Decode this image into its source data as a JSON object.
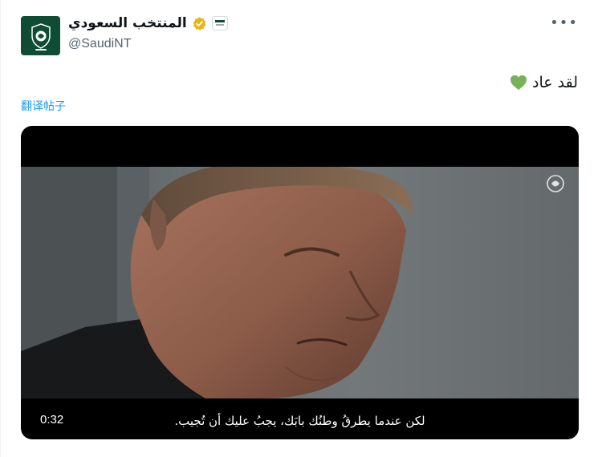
{
  "post": {
    "author": {
      "display_name": "المنتخب السعودي",
      "handle": "@SaudiNT",
      "verified_badge_color": "#e2b719",
      "avatar_icon": "saudi-team-crest-icon"
    },
    "more_icon": "more-dots-icon",
    "text": "لقد عاد",
    "text_emoji": "green-heart-icon",
    "translate_label": "翻译帖子",
    "video": {
      "duration": "0:32",
      "subtitle": "لكن عندما يطرقُ وطنُك بابَك، يجبُ عليك أن تُجيب."
    }
  },
  "colors": {
    "link": "#1d9bf0",
    "text": "#0f1419",
    "secondary_text": "#536471",
    "team_green": "#0e4d34"
  }
}
